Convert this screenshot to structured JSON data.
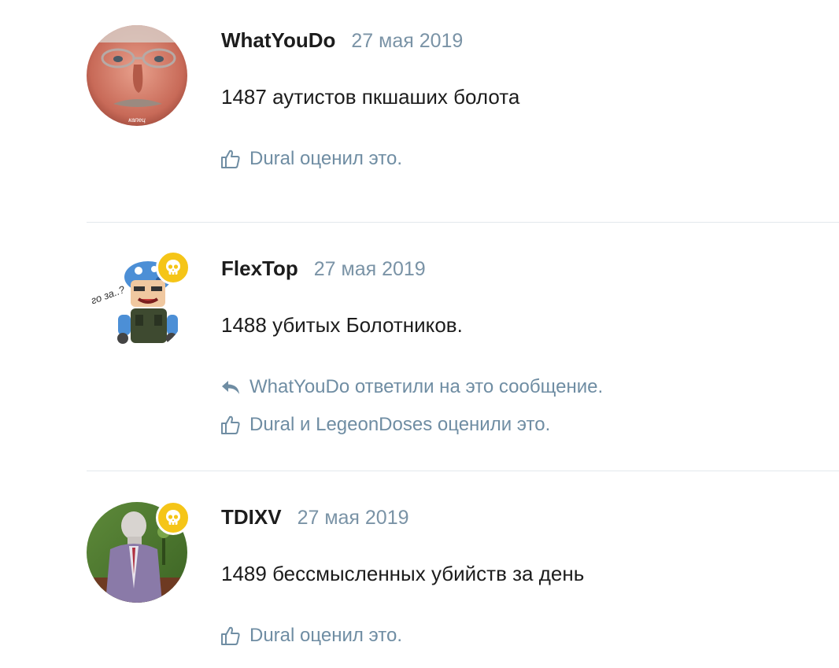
{
  "posts": [
    {
      "username": "WhatYouDo",
      "date": "27 мая 2019",
      "message": "1487 аутистов пкшаших болота",
      "has_badge": false,
      "avatar_caption": "капец",
      "reply_text": "",
      "likes_text": "Dural оценил это."
    },
    {
      "username": "FlexTop",
      "date": "27 мая 2019",
      "message": "1488 убитых Болотников.",
      "has_badge": true,
      "avatar_caption": "го за..?",
      "reply_text": "WhatYouDo ответили на это сообщение.",
      "likes_text": "Dural и LegeonDoses оценили это."
    },
    {
      "username": "TDIXV",
      "date": "27 мая 2019",
      "message": "1489 бессмысленных убийств за день",
      "has_badge": true,
      "avatar_caption": "",
      "reply_text": "",
      "likes_text": "Dural оценил это."
    }
  ],
  "colors": {
    "badge": "#f5c518",
    "muted_text": "#6f8da3",
    "date_text": "#7a93a6",
    "divider": "#e3e8ec"
  },
  "icons": {
    "like": "thumbs-up-icon",
    "reply": "reply-arrow-icon",
    "badge": "skull-icon"
  }
}
